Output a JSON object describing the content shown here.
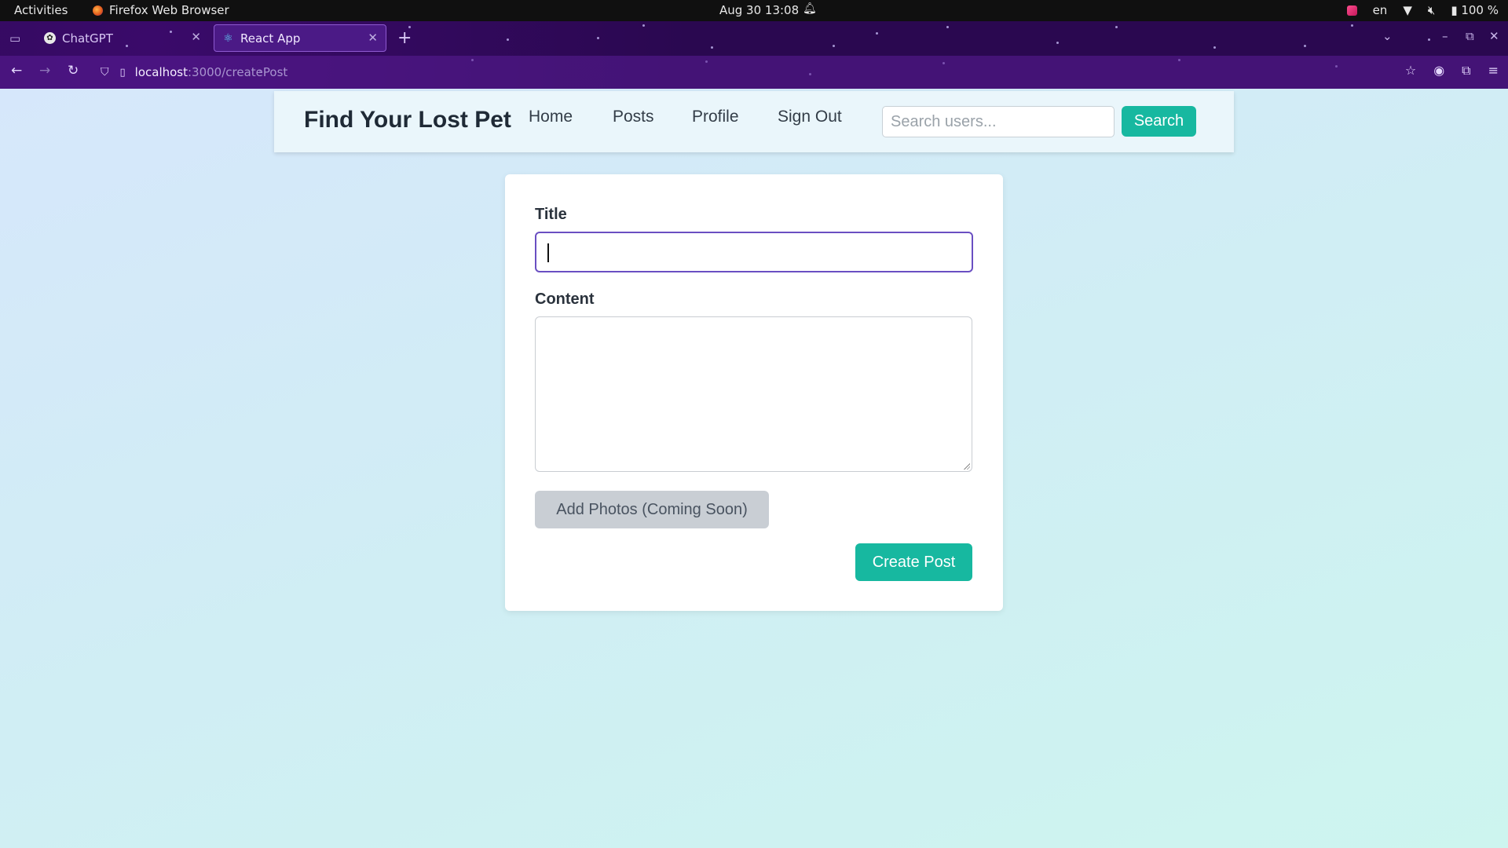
{
  "system_bar": {
    "activities": "Activities",
    "app_name": "Firefox Web Browser",
    "datetime": "Aug 30  13:08",
    "language": "en",
    "battery": "100 %"
  },
  "browser": {
    "tabs": [
      {
        "label": "ChatGPT",
        "active": false
      },
      {
        "label": "React App",
        "active": true
      }
    ],
    "url_host": "localhost",
    "url_path": ":3000/createPost"
  },
  "app_nav": {
    "brand": "Find Your Lost Pet",
    "links": [
      "Home",
      "Posts",
      "Profile",
      "Sign Out"
    ],
    "search_placeholder": "Search users...",
    "search_button": "Search"
  },
  "form": {
    "title_label": "Title",
    "title_value": "",
    "content_label": "Content",
    "content_value": "",
    "photos_button": "Add Photos (Coming Soon)",
    "submit_button": "Create Post"
  },
  "colors": {
    "accent": "#17b8a0",
    "focus_ring": "#6a4fc2",
    "browser_theme": "#2a0850"
  }
}
